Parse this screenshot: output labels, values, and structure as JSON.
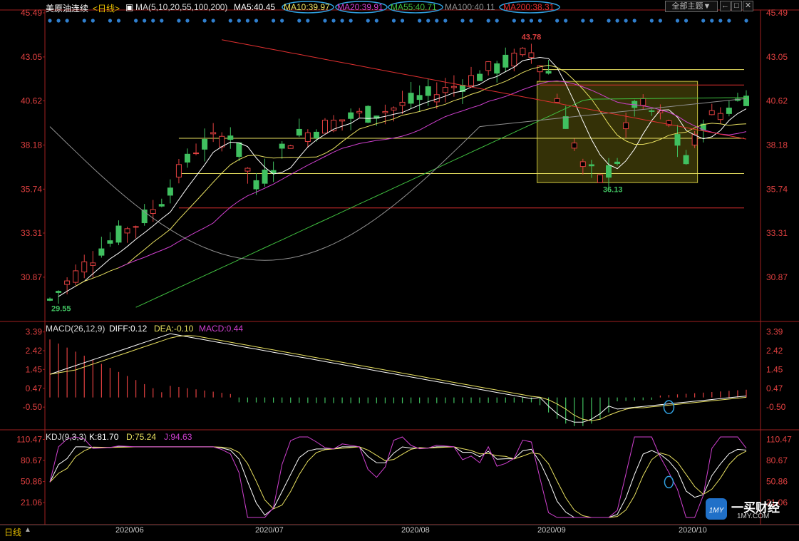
{
  "header": {
    "instrument": "美原油连续",
    "period": "<日线>",
    "ma_params": "MA(5,10,20,55,100,200)",
    "ma5": "MA5:40.45",
    "ma10": "MA10:39.97",
    "ma20": "MA20:39.91",
    "ma55": "MA55:40.71",
    "ma100": "MA100:40.11",
    "ma200": "MA200:38.31",
    "theme_button": "全部主题▼",
    "window_controls": [
      "←",
      "□",
      "✕"
    ]
  },
  "colors": {
    "up": "#e04040",
    "down": "#40c060",
    "ma5": "#ffffff",
    "ma10": "#e8e060",
    "ma20": "#d040d0",
    "ma55": "#40c040",
    "ma100": "#909090",
    "ma200": "#e03030",
    "dots": "#3080d0",
    "highlight": "#30a0e0"
  },
  "macd_panel": {
    "title": "MACD(26,12,9)",
    "diff": "DIFF:0.12",
    "dea": "DEA:-0.10",
    "macd": "MACD:0.44"
  },
  "kdj_panel": {
    "title": "KDJ(9,3,3)",
    "k": "K:81.70",
    "d": "D:75.24",
    "j": "J:94.63"
  },
  "footer": {
    "period_tab": "日线",
    "dates": [
      "2020/06",
      "2020/07",
      "2020/08",
      "2020/09",
      "2020/10"
    ]
  },
  "logo": {
    "text": "一买财经",
    "url_text": "1MY.COM"
  },
  "chart_data": [
    {
      "type": "candlestick",
      "panel": "price",
      "y_ticks": [
        45.49,
        43.05,
        40.62,
        38.18,
        35.74,
        33.31,
        30.87
      ],
      "ylim": [
        28.5,
        45.49
      ],
      "annotations": [
        {
          "label": "43.78",
          "kind": "high"
        },
        {
          "label": "36.13",
          "kind": "local-low"
        },
        {
          "label": "29.55",
          "kind": "low"
        }
      ],
      "horizontal_lines": [
        {
          "y": 42.35,
          "color": "#e8e060"
        },
        {
          "y": 41.5,
          "color": "#e03030"
        },
        {
          "y": 38.55,
          "color": "#e8e060"
        },
        {
          "y": 36.6,
          "color": "#e8e060"
        },
        {
          "y": 34.7,
          "color": "#e03030"
        }
      ],
      "box": {
        "from_index": 57,
        "to_index": 75,
        "y_low": 36.1,
        "y_high": 41.7
      },
      "series": [
        {
          "name": "MA5"
        },
        {
          "name": "MA10"
        },
        {
          "name": "MA20"
        },
        {
          "name": "MA55"
        },
        {
          "name": "MA100"
        },
        {
          "name": "MA200"
        }
      ]
    },
    {
      "type": "bar+line",
      "panel": "macd",
      "y_ticks": [
        3.39,
        2.42,
        1.45,
        0.47,
        -0.5
      ],
      "ylim": [
        -1.6,
        3.6
      ],
      "series": [
        {
          "name": "DIFF"
        },
        {
          "name": "DEA"
        },
        {
          "name": "MACD"
        }
      ]
    },
    {
      "type": "line",
      "panel": "kdj",
      "y_ticks": [
        110.47,
        80.67,
        50.86,
        21.06
      ],
      "ylim": [
        0,
        115
      ],
      "series": [
        {
          "name": "K"
        },
        {
          "name": "D"
        },
        {
          "name": "J"
        }
      ]
    }
  ]
}
